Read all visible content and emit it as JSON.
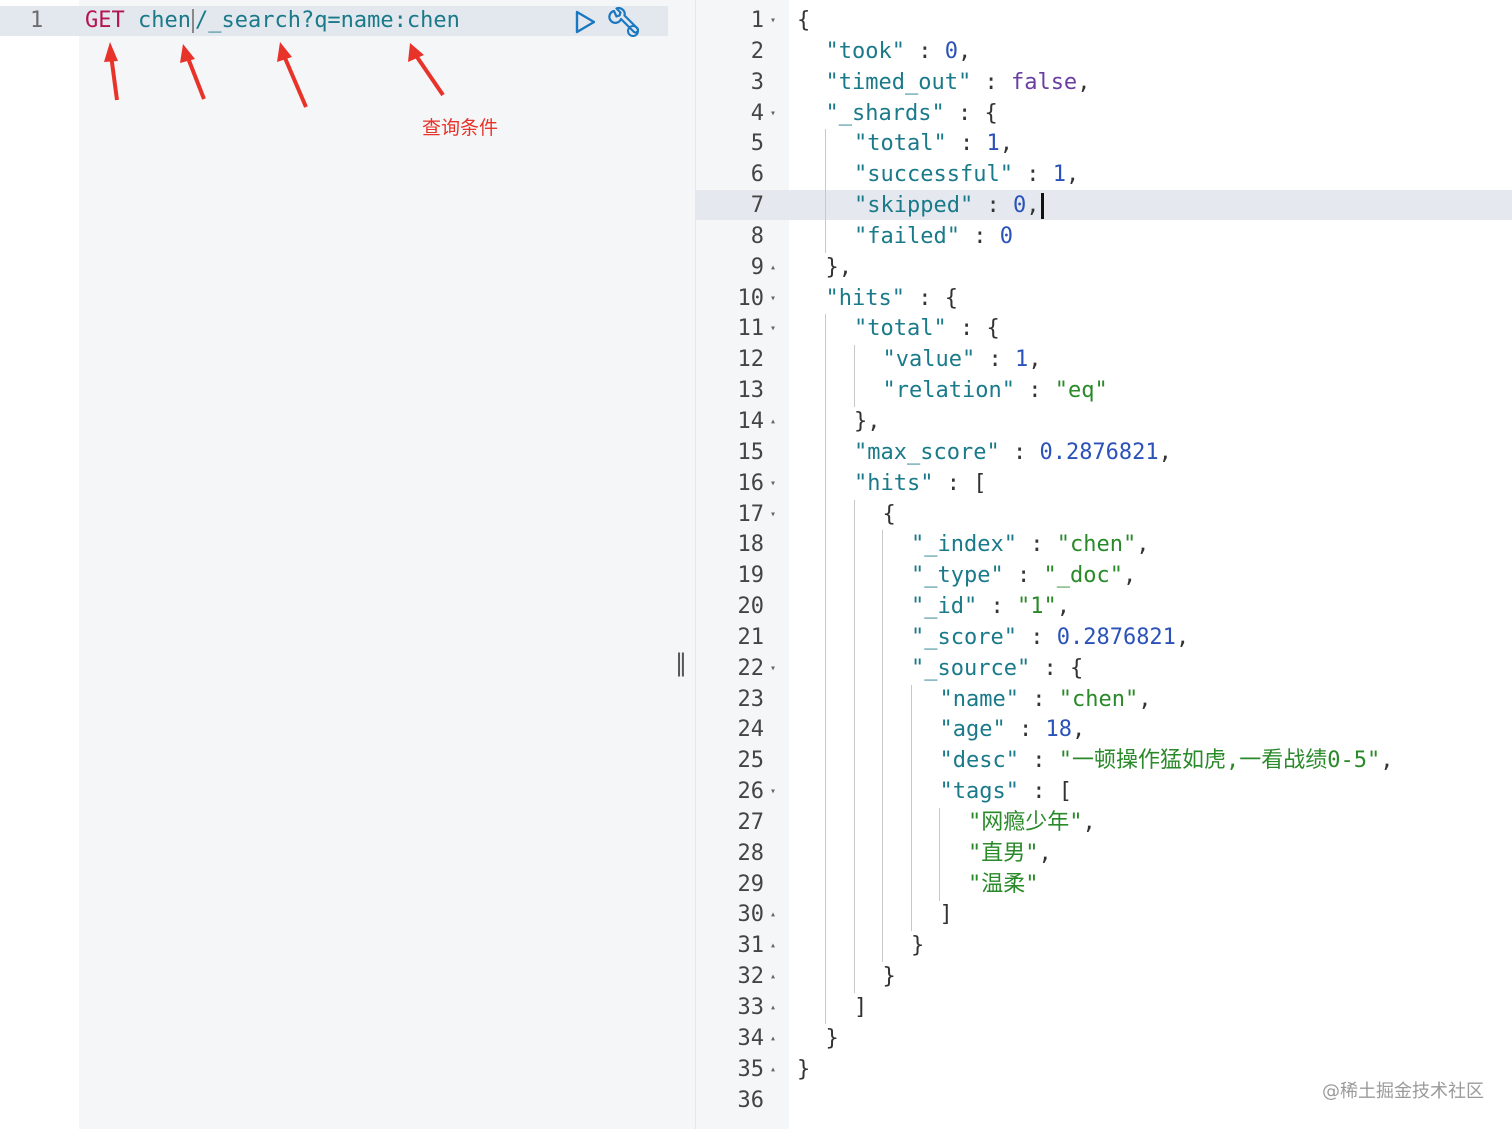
{
  "request": {
    "line_number": "1",
    "method": "GET",
    "index": "chen",
    "path": "/_search?q=name:chen"
  },
  "annotation": {
    "label": "查询条件",
    "color": "#e8332a"
  },
  "icons": {
    "run": "play-icon",
    "settings": "wrench-icon",
    "divider": "resize-handle-icon"
  },
  "divider": {
    "handle": "‖"
  },
  "response": {
    "lines": [
      {
        "n": "1",
        "fold": "▾",
        "indent": 0,
        "tokens": [
          [
            "p",
            "{"
          ]
        ]
      },
      {
        "n": "2",
        "fold": "",
        "indent": 1,
        "tokens": [
          [
            "k",
            "\"took\""
          ],
          [
            "p",
            " : "
          ],
          [
            "n",
            "0"
          ],
          [
            "p",
            ","
          ]
        ]
      },
      {
        "n": "3",
        "fold": "",
        "indent": 1,
        "tokens": [
          [
            "k",
            "\"timed_out\""
          ],
          [
            "p",
            " : "
          ],
          [
            "b",
            "false"
          ],
          [
            "p",
            ","
          ]
        ]
      },
      {
        "n": "4",
        "fold": "▾",
        "indent": 1,
        "tokens": [
          [
            "k",
            "\"_shards\""
          ],
          [
            "p",
            " : {"
          ]
        ]
      },
      {
        "n": "5",
        "fold": "",
        "indent": 2,
        "tokens": [
          [
            "k",
            "\"total\""
          ],
          [
            "p",
            " : "
          ],
          [
            "n",
            "1"
          ],
          [
            "p",
            ","
          ]
        ]
      },
      {
        "n": "6",
        "fold": "",
        "indent": 2,
        "tokens": [
          [
            "k",
            "\"successful\""
          ],
          [
            "p",
            " : "
          ],
          [
            "n",
            "1"
          ],
          [
            "p",
            ","
          ]
        ]
      },
      {
        "n": "7",
        "fold": "",
        "indent": 2,
        "cursor": true,
        "tokens": [
          [
            "k",
            "\"skipped\""
          ],
          [
            "p",
            " : "
          ],
          [
            "n",
            "0"
          ],
          [
            "p",
            ","
          ]
        ]
      },
      {
        "n": "8",
        "fold": "",
        "indent": 2,
        "tokens": [
          [
            "k",
            "\"failed\""
          ],
          [
            "p",
            " : "
          ],
          [
            "n",
            "0"
          ]
        ]
      },
      {
        "n": "9",
        "fold": "▴",
        "indent": 1,
        "tokens": [
          [
            "p",
            "},"
          ]
        ]
      },
      {
        "n": "10",
        "fold": "▾",
        "indent": 1,
        "tokens": [
          [
            "k",
            "\"hits\""
          ],
          [
            "p",
            " : {"
          ]
        ]
      },
      {
        "n": "11",
        "fold": "▾",
        "indent": 2,
        "tokens": [
          [
            "k",
            "\"total\""
          ],
          [
            "p",
            " : {"
          ]
        ]
      },
      {
        "n": "12",
        "fold": "",
        "indent": 3,
        "tokens": [
          [
            "k",
            "\"value\""
          ],
          [
            "p",
            " : "
          ],
          [
            "n",
            "1"
          ],
          [
            "p",
            ","
          ]
        ]
      },
      {
        "n": "13",
        "fold": "",
        "indent": 3,
        "tokens": [
          [
            "k",
            "\"relation\""
          ],
          [
            "p",
            " : "
          ],
          [
            "s",
            "\"eq\""
          ]
        ]
      },
      {
        "n": "14",
        "fold": "▴",
        "indent": 2,
        "tokens": [
          [
            "p",
            "},"
          ]
        ]
      },
      {
        "n": "15",
        "fold": "",
        "indent": 2,
        "tokens": [
          [
            "k",
            "\"max_score\""
          ],
          [
            "p",
            " : "
          ],
          [
            "n",
            "0.2876821"
          ],
          [
            "p",
            ","
          ]
        ]
      },
      {
        "n": "16",
        "fold": "▾",
        "indent": 2,
        "tokens": [
          [
            "k",
            "\"hits\""
          ],
          [
            "p",
            " : ["
          ]
        ]
      },
      {
        "n": "17",
        "fold": "▾",
        "indent": 3,
        "tokens": [
          [
            "p",
            "{"
          ]
        ]
      },
      {
        "n": "18",
        "fold": "",
        "indent": 4,
        "tokens": [
          [
            "k",
            "\"_index\""
          ],
          [
            "p",
            " : "
          ],
          [
            "s",
            "\"chen\""
          ],
          [
            "p",
            ","
          ]
        ]
      },
      {
        "n": "19",
        "fold": "",
        "indent": 4,
        "tokens": [
          [
            "k",
            "\"_type\""
          ],
          [
            "p",
            " : "
          ],
          [
            "s",
            "\"_doc\""
          ],
          [
            "p",
            ","
          ]
        ]
      },
      {
        "n": "20",
        "fold": "",
        "indent": 4,
        "tokens": [
          [
            "k",
            "\"_id\""
          ],
          [
            "p",
            " : "
          ],
          [
            "s",
            "\"1\""
          ],
          [
            "p",
            ","
          ]
        ]
      },
      {
        "n": "21",
        "fold": "",
        "indent": 4,
        "tokens": [
          [
            "k",
            "\"_score\""
          ],
          [
            "p",
            " : "
          ],
          [
            "n",
            "0.2876821"
          ],
          [
            "p",
            ","
          ]
        ]
      },
      {
        "n": "22",
        "fold": "▾",
        "indent": 4,
        "tokens": [
          [
            "k",
            "\"_source\""
          ],
          [
            "p",
            " : {"
          ]
        ]
      },
      {
        "n": "23",
        "fold": "",
        "indent": 5,
        "tokens": [
          [
            "k",
            "\"name\""
          ],
          [
            "p",
            " : "
          ],
          [
            "s",
            "\"chen\""
          ],
          [
            "p",
            ","
          ]
        ]
      },
      {
        "n": "24",
        "fold": "",
        "indent": 5,
        "tokens": [
          [
            "k",
            "\"age\""
          ],
          [
            "p",
            " : "
          ],
          [
            "n",
            "18"
          ],
          [
            "p",
            ","
          ]
        ]
      },
      {
        "n": "25",
        "fold": "",
        "indent": 5,
        "tokens": [
          [
            "k",
            "\"desc\""
          ],
          [
            "p",
            " : "
          ],
          [
            "s",
            "\"一顿操作猛如虎,一看战绩0-5\""
          ],
          [
            "p",
            ","
          ]
        ]
      },
      {
        "n": "26",
        "fold": "▾",
        "indent": 5,
        "tokens": [
          [
            "k",
            "\"tags\""
          ],
          [
            "p",
            " : ["
          ]
        ]
      },
      {
        "n": "27",
        "fold": "",
        "indent": 6,
        "tokens": [
          [
            "s",
            "\"网瘾少年\""
          ],
          [
            "p",
            ","
          ]
        ]
      },
      {
        "n": "28",
        "fold": "",
        "indent": 6,
        "tokens": [
          [
            "s",
            "\"直男\""
          ],
          [
            "p",
            ","
          ]
        ]
      },
      {
        "n": "29",
        "fold": "",
        "indent": 6,
        "tokens": [
          [
            "s",
            "\"温柔\""
          ]
        ]
      },
      {
        "n": "30",
        "fold": "▴",
        "indent": 5,
        "tokens": [
          [
            "p",
            "]"
          ]
        ]
      },
      {
        "n": "31",
        "fold": "▴",
        "indent": 4,
        "tokens": [
          [
            "p",
            "}"
          ]
        ]
      },
      {
        "n": "32",
        "fold": "▴",
        "indent": 3,
        "tokens": [
          [
            "p",
            "}"
          ]
        ]
      },
      {
        "n": "33",
        "fold": "▴",
        "indent": 2,
        "tokens": [
          [
            "p",
            "]"
          ]
        ]
      },
      {
        "n": "34",
        "fold": "▴",
        "indent": 1,
        "tokens": [
          [
            "p",
            "}"
          ]
        ]
      },
      {
        "n": "35",
        "fold": "▴",
        "indent": 0,
        "tokens": [
          [
            "p",
            "}"
          ]
        ]
      },
      {
        "n": "36",
        "fold": "",
        "indent": 0,
        "tokens": []
      }
    ]
  },
  "watermark": "@稀土掘金技术社区"
}
